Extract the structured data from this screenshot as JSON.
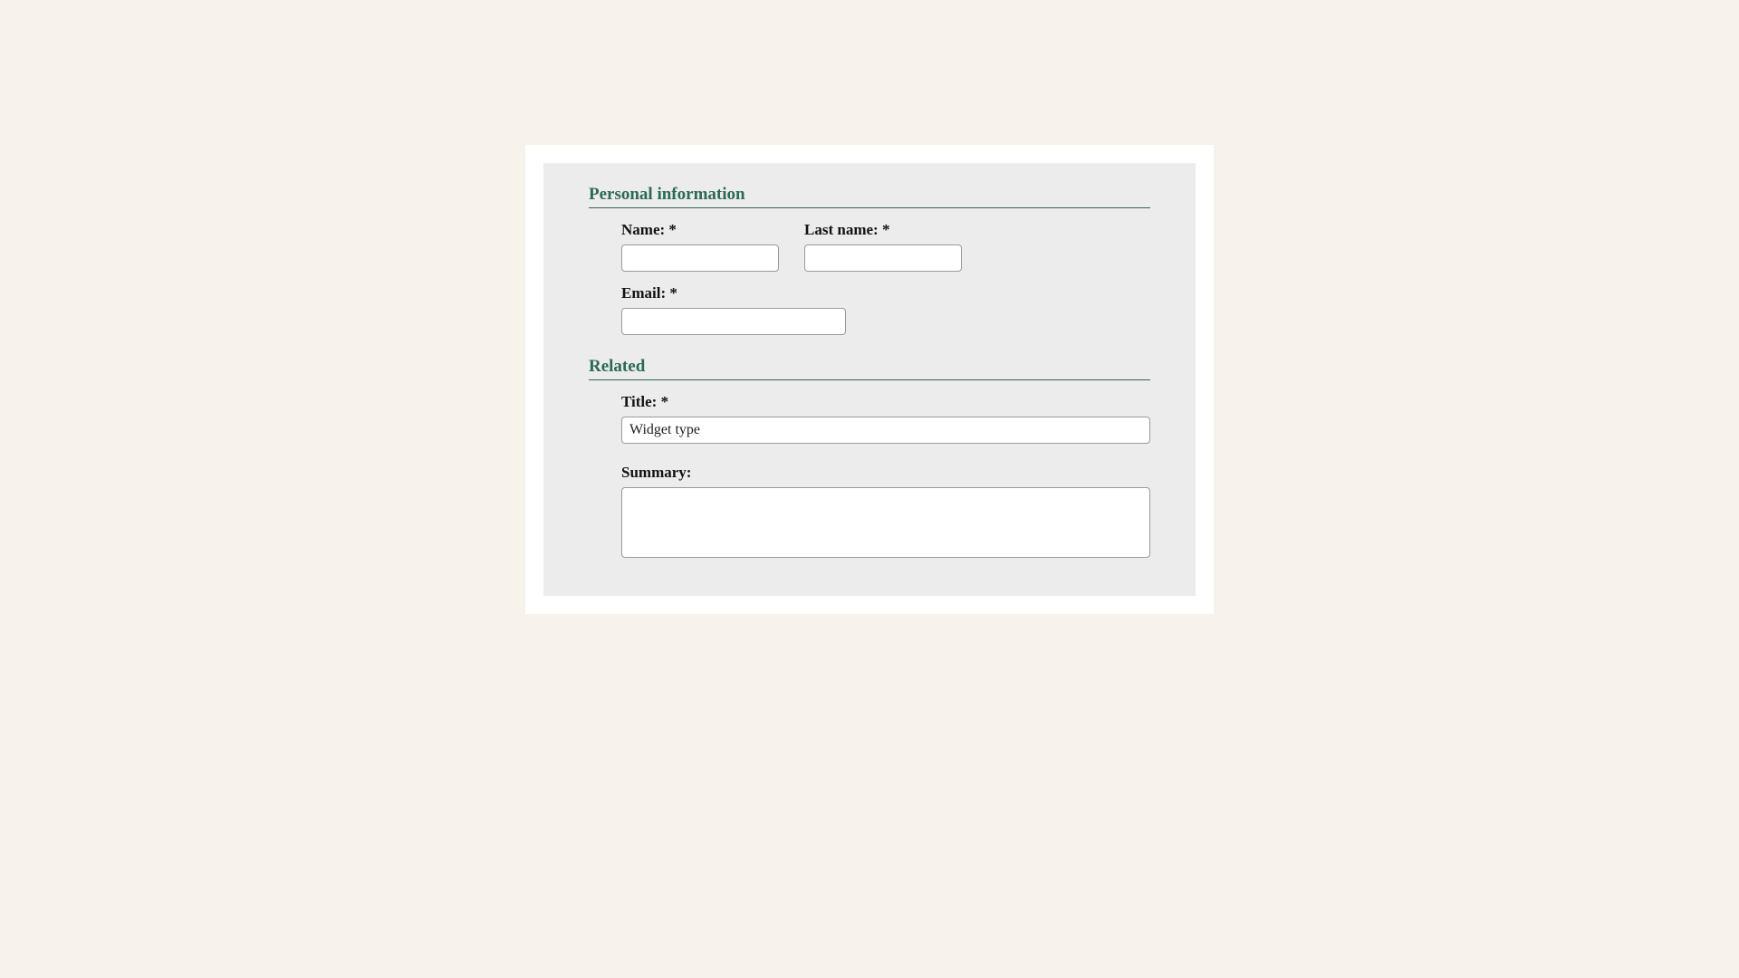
{
  "sections": {
    "personal": {
      "title": "Personal information",
      "fields": {
        "name": {
          "label": "Name:",
          "value": ""
        },
        "last_name": {
          "label": "Last name:",
          "value": ""
        },
        "email": {
          "label": "Email:",
          "value": ""
        }
      }
    },
    "related": {
      "title": "Related",
      "fields": {
        "title": {
          "label": "Title:",
          "value": "Widget type"
        },
        "summary": {
          "label": "Summary:",
          "value": ""
        }
      }
    }
  }
}
